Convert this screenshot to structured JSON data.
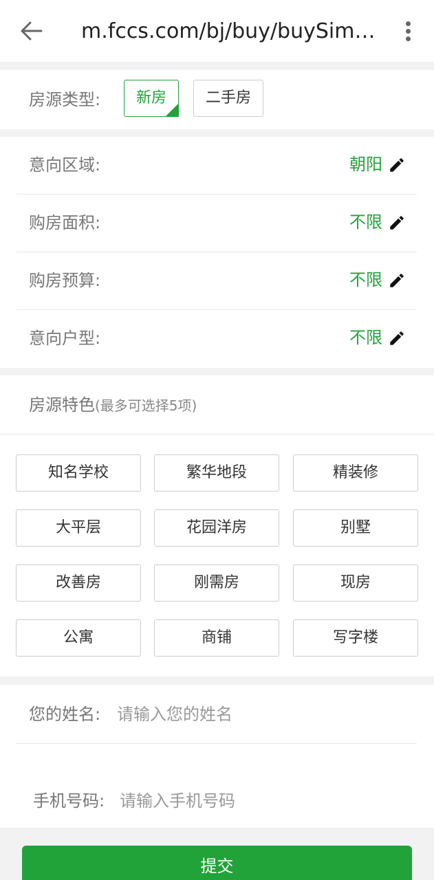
{
  "browser": {
    "url": "m.fccs.com/bj/buy/buySim…",
    "back_icon": "arrow-left-icon",
    "menu_icon": "more-vertical-icon"
  },
  "house_type": {
    "label": "房源类型:",
    "options": [
      "新房",
      "二手房"
    ],
    "selected": "新房"
  },
  "preferences": [
    {
      "label": "意向区域:",
      "value": "朝阳"
    },
    {
      "label": "购房面积:",
      "value": "不限"
    },
    {
      "label": "购房预算:",
      "value": "不限"
    },
    {
      "label": "意向户型:",
      "value": "不限"
    }
  ],
  "features": {
    "title": "房源特色",
    "hint": "(最多可选择5项)",
    "items": [
      "知名学校",
      "繁华地段",
      "精装修",
      "大平层",
      "花园洋房",
      "别墅",
      "改善房",
      "刚需房",
      "现房",
      "公寓",
      "商铺",
      "写字楼"
    ]
  },
  "contact": {
    "name_label": "您的姓名:",
    "name_placeholder": "请输入您的姓名",
    "phone_label": "手机号码:",
    "phone_placeholder": "请输入手机号码"
  },
  "submit_label": "提交",
  "colors": {
    "accent": "#22a33a",
    "background": "#f2f2f2"
  }
}
